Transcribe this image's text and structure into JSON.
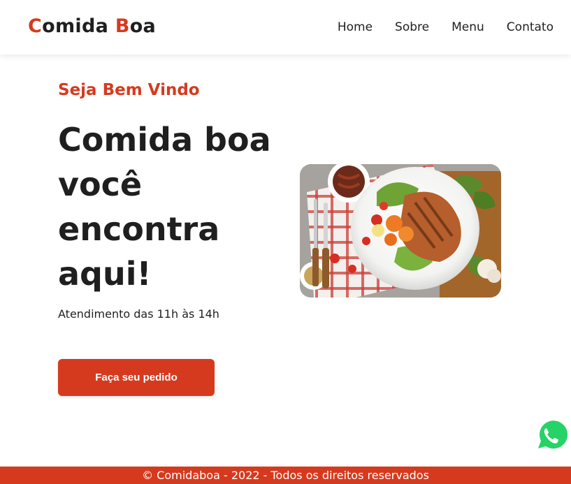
{
  "header": {
    "logo": {
      "first_initial": "C",
      "first_rest": "omida ",
      "second_initial": "B",
      "second_rest": "oa"
    },
    "nav": [
      "Home",
      "Sobre",
      "Menu",
      "Contato"
    ]
  },
  "hero": {
    "welcome": "Seja Bem Vindo",
    "headline": "Comida boa você encontra aqui!",
    "hours": "Atendimento das 11h às 14h",
    "cta_label": "Faça seu pedido",
    "image_icon": "grilled-fish-plate-photo"
  },
  "floating": {
    "whatsapp_icon": "whatsapp-icon"
  },
  "footer": {
    "text": "© Comidaboa - 2022 - Todos os direitos reservados"
  },
  "colors": {
    "accent": "#d63a1e",
    "text": "#1f1f1f",
    "background": "#ffffff",
    "whatsapp": "#25d366"
  }
}
